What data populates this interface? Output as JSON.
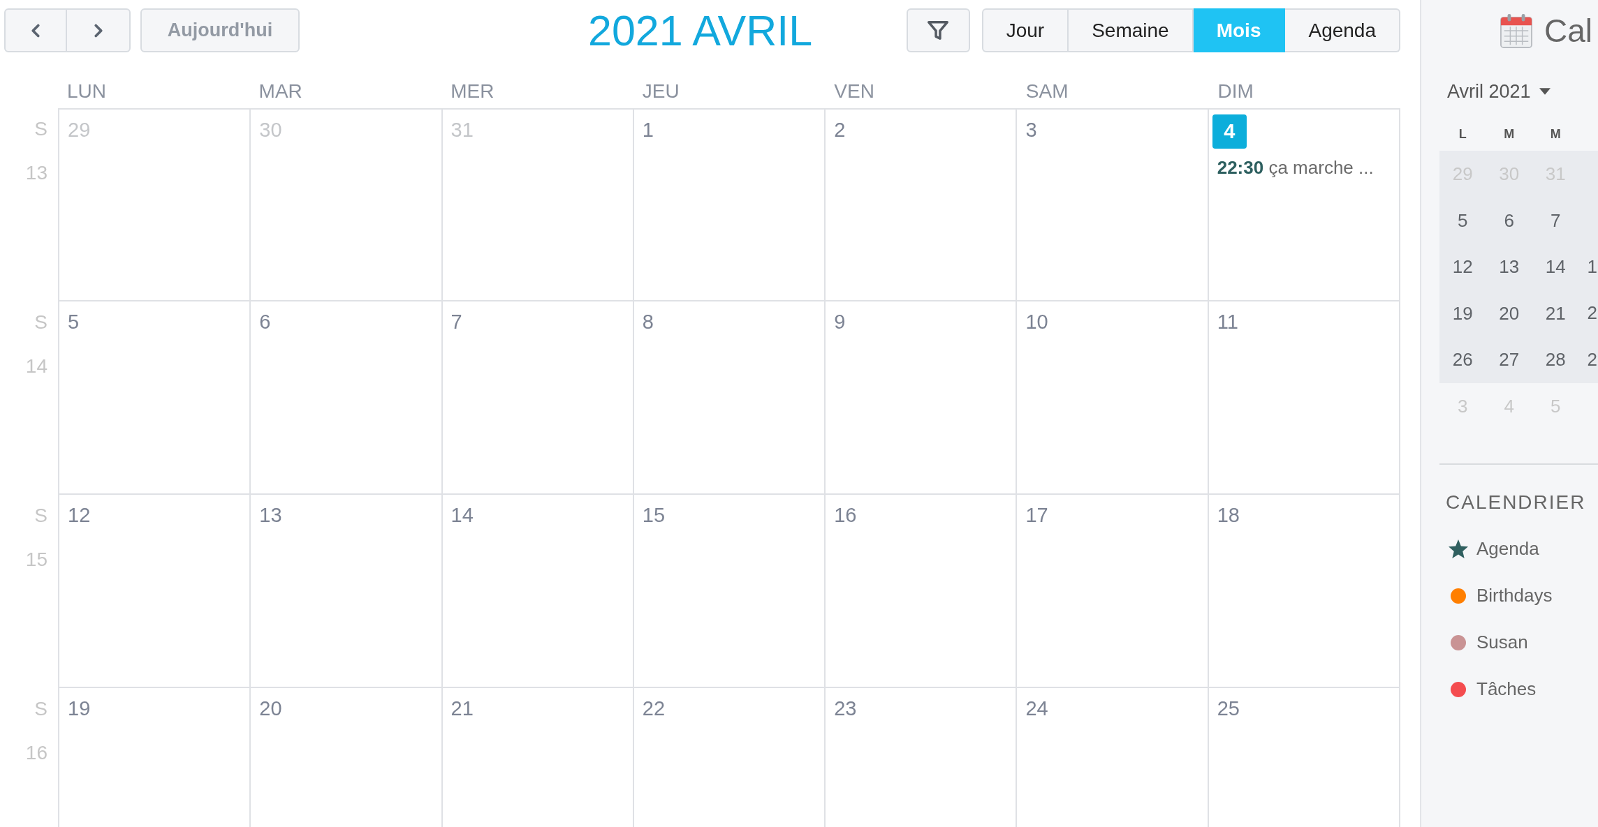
{
  "toolbar": {
    "today_button": {
      "label": "Aujourd'hui",
      "disabled": true
    },
    "title": "2021 AVRIL",
    "views": [
      {
        "label": "Jour",
        "selected": false
      },
      {
        "label": "Semaine",
        "selected": false
      },
      {
        "label": "Mois",
        "selected": true
      },
      {
        "label": "Agenda",
        "selected": false
      }
    ]
  },
  "month": {
    "weekdays": [
      "LUN",
      "MAR",
      "MER",
      "JEU",
      "VEN",
      "SAM",
      "DIM"
    ],
    "weeks": [
      {
        "week_label": "S",
        "week_number": "13",
        "days": [
          {
            "day": "29",
            "outside": true,
            "today": false
          },
          {
            "day": "30",
            "outside": true,
            "today": false
          },
          {
            "day": "31",
            "outside": true,
            "today": false
          },
          {
            "day": "1",
            "outside": false,
            "today": false
          },
          {
            "day": "2",
            "outside": false,
            "today": false
          },
          {
            "day": "3",
            "outside": false,
            "today": false
          },
          {
            "day": "4",
            "outside": false,
            "today": true,
            "events": [
              {
                "time": "22:30",
                "title": "ça marche ..."
              }
            ]
          }
        ]
      },
      {
        "week_label": "S",
        "week_number": "14",
        "days": [
          {
            "day": "5",
            "outside": false,
            "today": false
          },
          {
            "day": "6",
            "outside": false,
            "today": false
          },
          {
            "day": "7",
            "outside": false,
            "today": false
          },
          {
            "day": "8",
            "outside": false,
            "today": false
          },
          {
            "day": "9",
            "outside": false,
            "today": false
          },
          {
            "day": "10",
            "outside": false,
            "today": false
          },
          {
            "day": "11",
            "outside": false,
            "today": false
          }
        ]
      },
      {
        "week_label": "S",
        "week_number": "15",
        "days": [
          {
            "day": "12",
            "outside": false,
            "today": false
          },
          {
            "day": "13",
            "outside": false,
            "today": false
          },
          {
            "day": "14",
            "outside": false,
            "today": false
          },
          {
            "day": "15",
            "outside": false,
            "today": false
          },
          {
            "day": "16",
            "outside": false,
            "today": false
          },
          {
            "day": "17",
            "outside": false,
            "today": false
          },
          {
            "day": "18",
            "outside": false,
            "today": false
          }
        ]
      },
      {
        "week_label": "S",
        "week_number": "16",
        "days": [
          {
            "day": "19",
            "outside": false,
            "today": false
          },
          {
            "day": "20",
            "outside": false,
            "today": false
          },
          {
            "day": "21",
            "outside": false,
            "today": false
          },
          {
            "day": "22",
            "outside": false,
            "today": false
          },
          {
            "day": "23",
            "outside": false,
            "today": false
          },
          {
            "day": "24",
            "outside": false,
            "today": false
          },
          {
            "day": "25",
            "outside": false,
            "today": false
          }
        ]
      }
    ]
  },
  "sidebar": {
    "title": "Cal",
    "mini_calendar": {
      "month_label": "Avril 2021",
      "weekdays": [
        "L",
        "M",
        "M"
      ],
      "weeks": [
        {
          "highlighted": true,
          "days": [
            {
              "day": "29",
              "outside": true
            },
            {
              "day": "30",
              "outside": true
            },
            {
              "day": "31",
              "outside": true
            }
          ]
        },
        {
          "highlighted": true,
          "days": [
            {
              "day": "5",
              "outside": false
            },
            {
              "day": "6",
              "outside": false
            },
            {
              "day": "7",
              "outside": false
            }
          ]
        },
        {
          "highlighted": true,
          "days": [
            {
              "day": "12",
              "outside": false
            },
            {
              "day": "13",
              "outside": false
            },
            {
              "day": "14",
              "outside": false
            },
            {
              "day": "1",
              "outside": false
            }
          ]
        },
        {
          "highlighted": true,
          "days": [
            {
              "day": "19",
              "outside": false
            },
            {
              "day": "20",
              "outside": false
            },
            {
              "day": "21",
              "outside": false
            },
            {
              "day": "2",
              "outside": false
            }
          ]
        },
        {
          "highlighted": true,
          "days": [
            {
              "day": "26",
              "outside": false
            },
            {
              "day": "27",
              "outside": false
            },
            {
              "day": "28",
              "outside": false
            },
            {
              "day": "2",
              "outside": false
            }
          ]
        },
        {
          "highlighted": false,
          "days": [
            {
              "day": "3",
              "outside": true
            },
            {
              "day": "4",
              "outside": true
            },
            {
              "day": "5",
              "outside": true
            }
          ]
        }
      ]
    },
    "calendars_heading": "CALENDRIER",
    "calendars": [
      {
        "name": "Agenda",
        "kind": "star",
        "color": "#2f5f5f"
      },
      {
        "name": "Birthdays",
        "kind": "dot",
        "color": "#ff7f00"
      },
      {
        "name": "Susan",
        "kind": "dot",
        "color": "#c99394"
      },
      {
        "name": "Tâches",
        "kind": "dot",
        "color": "#f44c4f"
      }
    ]
  }
}
